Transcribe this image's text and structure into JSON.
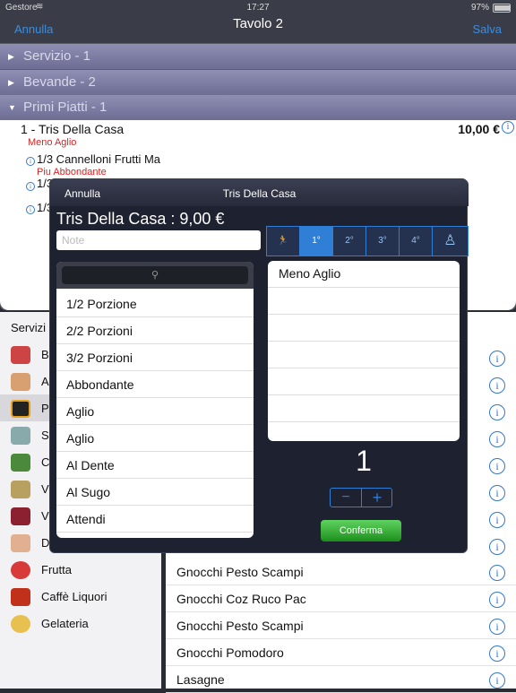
{
  "status": {
    "carrier": "Gestore",
    "time": "17:27",
    "battery": "97%"
  },
  "nav": {
    "left": "Annulla",
    "title": "Tavolo 2",
    "right": "Salva"
  },
  "sections": [
    {
      "label": "Servizio - 1"
    },
    {
      "label": "Bevande - 2"
    },
    {
      "label": "Primi Piatti - 1"
    }
  ],
  "order": {
    "main": {
      "name": "1 - Tris Della Casa",
      "price": "10,00 €",
      "mod": "Meno  Aglio"
    },
    "sub1": {
      "name": "1/3 Cannelloni Frutti Ma",
      "mod": "Piu  Abbondante"
    },
    "sub2": {
      "name": "1/3"
    },
    "sub3": {
      "name": "1/3"
    }
  },
  "categories_header": "Servizi",
  "categories": [
    {
      "label": "B"
    },
    {
      "label": "A"
    },
    {
      "label": "P"
    },
    {
      "label": "S"
    },
    {
      "label": "C"
    },
    {
      "label": "V"
    },
    {
      "label": "V"
    },
    {
      "label": "D"
    },
    {
      "label": "Frutta"
    },
    {
      "label": "Caffè Liquori"
    },
    {
      "label": "Gelateria"
    }
  ],
  "products": [
    {
      "label": "Gnocchi Pesto Scampi"
    },
    {
      "label": "Gnocchi Coz Ruco Pac"
    },
    {
      "label": "Gnocchi Pesto Scampi"
    },
    {
      "label": "Gnocchi Pomodoro"
    },
    {
      "label": "Lasagne"
    }
  ],
  "modal": {
    "cancel": "Annulla",
    "title": "Tris Della Casa",
    "price_line": "Tris Della Casa  :  9,00 €",
    "note_placeholder": "Note",
    "search_icon": "search-icon",
    "options": [
      "1/2 Porzione",
      "2/2 Porzioni",
      "3/2 Porzioni",
      "Abbondante",
      "Aglio",
      "Aglio",
      "Al Dente",
      "Al Sugo",
      "Attendi"
    ],
    "segments": [
      "1°",
      "2°",
      "3°",
      "4°"
    ],
    "selected_mods": [
      "Meno  Aglio"
    ],
    "quantity": "1",
    "stepper_minus": "−",
    "stepper_plus": "+",
    "confirm": "Conferma"
  },
  "colors": {
    "accent": "#2f7fd6",
    "confirm": "#2ea82e",
    "section": "#7a7aa0",
    "modifier": "#d22222"
  }
}
